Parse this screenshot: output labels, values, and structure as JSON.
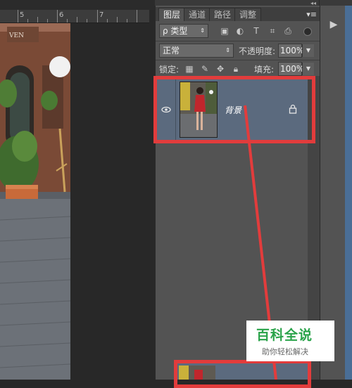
{
  "ruler": {
    "marks": [
      "5",
      "6",
      "7"
    ]
  },
  "panel": {
    "tabs": [
      {
        "label": "图层",
        "active": true
      },
      {
        "label": "通道",
        "active": false
      },
      {
        "label": "路径",
        "active": false
      },
      {
        "label": "调整",
        "active": false
      }
    ],
    "filter": {
      "label": "ρ 类型",
      "icons": [
        "image-filter-icon",
        "adjustment-filter-icon",
        "type-filter-icon",
        "shape-filter-icon",
        "smart-object-filter-icon"
      ]
    },
    "blend_mode": "正常",
    "opacity": {
      "label": "不透明度:",
      "value": "100%"
    },
    "lock": {
      "label": "锁定:",
      "icons": [
        "lock-transparent-icon",
        "lock-paint-icon",
        "lock-position-icon",
        "lock-all-icon"
      ]
    },
    "fill": {
      "label": "填充:",
      "value": "100%"
    },
    "layers": [
      {
        "name": "背景",
        "visible": true,
        "locked": true,
        "selected": true
      }
    ]
  },
  "watermark": {
    "logo": "百科全说",
    "tagline": "助你轻松解决"
  },
  "colors": {
    "highlight": "#e23c3c",
    "panel_bg": "#535353",
    "selected_row": "#5b6a7e",
    "logo_green": "#2aa34a"
  }
}
